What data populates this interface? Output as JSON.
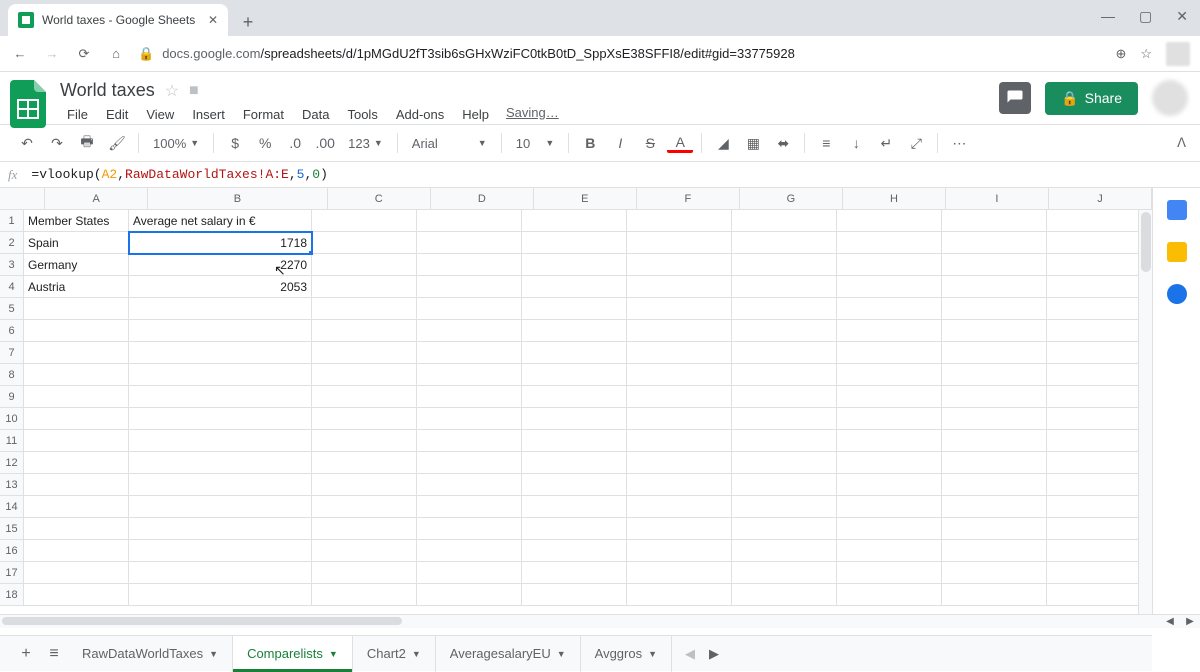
{
  "browser": {
    "tab_title": "World taxes - Google Sheets",
    "url_host": "docs.google.com",
    "url_path": "/spreadsheets/d/1pMGdU2fT3sib6sGHxWziFC0tkB0tD_SppXsE38SFFI8/edit#gid=33775928"
  },
  "doc": {
    "title": "World taxes",
    "saving": "Saving…"
  },
  "menus": [
    "File",
    "Edit",
    "View",
    "Insert",
    "Format",
    "Data",
    "Tools",
    "Add-ons",
    "Help"
  ],
  "toolbar": {
    "zoom": "100%",
    "num_fmt": "123",
    "font": "Arial",
    "size": "10"
  },
  "share_label": "Share",
  "formula": {
    "prefix": "=vlookup(",
    "ref1": "A2",
    "comma1": ",",
    "ref2": "RawDataWorldTaxes!A:E",
    "comma2": ",",
    "num1": "5",
    "comma3": ",",
    "num2": "0",
    "suffix": ")"
  },
  "columns": [
    "A",
    "B",
    "C",
    "D",
    "E",
    "F",
    "G",
    "H",
    "I",
    "J"
  ],
  "rows": [
    1,
    2,
    3,
    4,
    5,
    6,
    7,
    8,
    9,
    10,
    11,
    12,
    13,
    14,
    15,
    16,
    17,
    18
  ],
  "cells": {
    "A1": "Member States",
    "B1": "Average net salary in €",
    "A2": "Spain",
    "B2": "1718",
    "A3": "Germany",
    "B3": "2270",
    "A4": "Austria",
    "B4": "2053"
  },
  "sheets": {
    "list": [
      "RawDataWorldTaxes",
      "Comparelists",
      "Chart2",
      "AveragesalaryEU",
      "Avggros"
    ],
    "active": "Comparelists"
  }
}
